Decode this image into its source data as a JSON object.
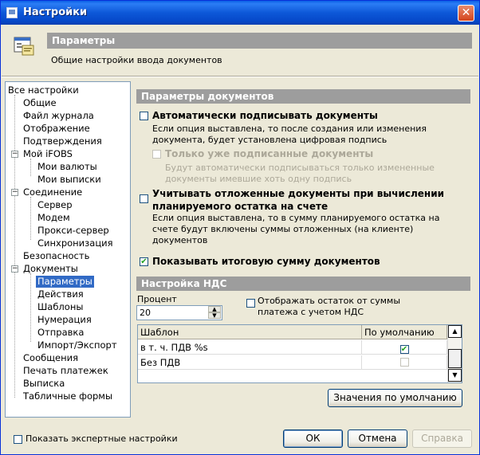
{
  "window": {
    "title": "Настройки",
    "close_glyph": "✕"
  },
  "header": {
    "title": "Параметры",
    "description": "Общие настройки ввода документов"
  },
  "tree": {
    "root": "Все настройки",
    "items": [
      "Общие",
      "Файл журнала",
      "Отображение",
      "Подтверждения",
      "Мой iFOBS",
      "Мои валюты",
      "Мои выписки",
      "Соединение",
      "Сервер",
      "Модем",
      "Прокси-сервер",
      "Синхронизация",
      "Безопасность",
      "Документы",
      "Параметры",
      "Действия",
      "Шаблоны",
      "Нумерация",
      "Отправка",
      "Импорт/Экспорт",
      "Сообщения",
      "Печать платежек",
      "Выписка",
      "Табличные формы"
    ],
    "expand_glyph": "−"
  },
  "docs": {
    "section_title": "Параметры документов",
    "opt1_label": "Автоматически подписывать документы",
    "opt1_desc1": "Если опция выставлена, то после создания или изменения",
    "opt1_desc2": "документа, будет установлена цифровая подпись",
    "opt2_label": "Только уже подписанные документы",
    "opt2_desc1": "Будут автоматически подписываться только измененные",
    "opt2_desc2": "документы имевшие хоть одну подпись",
    "opt3_label1": "Учитывать отложенные документы при вычислении",
    "opt3_label2": "планируемого остатка на счете",
    "opt3_desc1": "Если опция выставлена, то в сумму планируемого остатка на",
    "opt3_desc2": "счете будут включены суммы отложенных (на клиенте)",
    "opt3_desc3": "документов",
    "opt4_label": "Показывать итоговую сумму документов",
    "check_glyph": "✔"
  },
  "vat": {
    "section_title": "Настройка НДС",
    "percent_label": "Процент",
    "percent_value": "20",
    "spin_up": "▲",
    "spin_down": "▼",
    "show_rest_label1": "Отображать остаток от суммы",
    "show_rest_label2": "платежа с учетом НДС",
    "columns": [
      "Шаблон",
      "По умолчанию"
    ],
    "rows": [
      {
        "template": "в т. ч. ПДВ %s",
        "default": "✔"
      },
      {
        "template": "Без ПДВ",
        "default": ""
      }
    ],
    "defaults_button": "Значения по умолчанию"
  },
  "footer": {
    "expert_label": "Показать экспертные настройки",
    "ok": "ОК",
    "cancel": "Отмена",
    "help": "Справка"
  }
}
